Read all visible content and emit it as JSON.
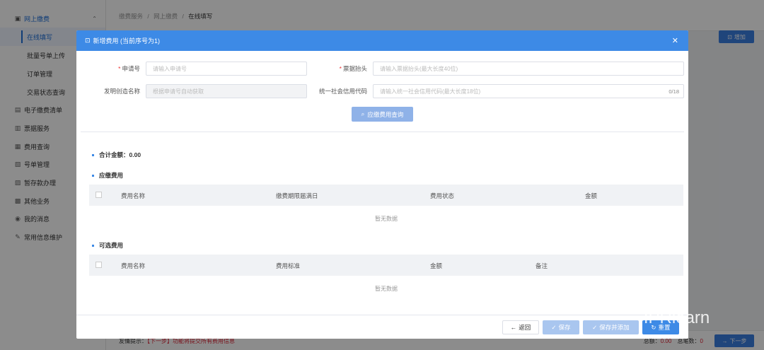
{
  "sidebar": {
    "group": "网上缴费",
    "sub_items": [
      "在线填写",
      "批量号单上传",
      "订单管理",
      "交易状态查询"
    ],
    "items": [
      "电子缴费清单",
      "票据服务",
      "费用查询",
      "号单管理",
      "暂存款办理",
      "其他业务",
      "我的消息",
      "常用信息维护"
    ]
  },
  "breadcrumb": [
    "缴费服务",
    "/",
    "网上缴费",
    "/",
    "在线填写"
  ],
  "add_button": "增加",
  "modal": {
    "title": "新增费用 (当前序号为1)",
    "fields": {
      "application_no_label": "申请号",
      "application_no_placeholder": "请输入申请号",
      "invoice_title_label": "票据抬头",
      "invoice_title_placeholder": "请输入票据抬头(最大长度40位)",
      "invention_name_label": "发明创造名称",
      "invention_name_placeholder": "根据申请号自动获取",
      "credit_code_label": "统一社会信用代码",
      "credit_code_placeholder": "请输入统一社会信用代码(最大长度18位)",
      "credit_code_counter": "0/18"
    },
    "query_button": "应缴费用查询",
    "total": "合计金额：0.00",
    "due_section": "应缴费用",
    "due_columns": [
      "费用名称",
      "缴费期限届满日",
      "费用状态",
      "金额"
    ],
    "empty_text": "暂无数据",
    "optional_section": "可选费用",
    "optional_columns": [
      "费用名称",
      "费用标准",
      "金额",
      "备注"
    ],
    "buttons": {
      "back": "返回",
      "save": "保存",
      "save_add": "保存并添加",
      "reset": "重置"
    }
  },
  "footer": {
    "hint_prefix": "友情提示：",
    "hint": "【下一步】功能将提交所有费用信息",
    "stats_total_label": "总额：",
    "stats_total": "0.00",
    "stats_count_label": "总笔数：",
    "stats_count": "0",
    "next_button": "下一步"
  },
  "watermark": "IPRlearn",
  "colors": {
    "primary": "#3d8ae6",
    "required": "#ee3333"
  }
}
